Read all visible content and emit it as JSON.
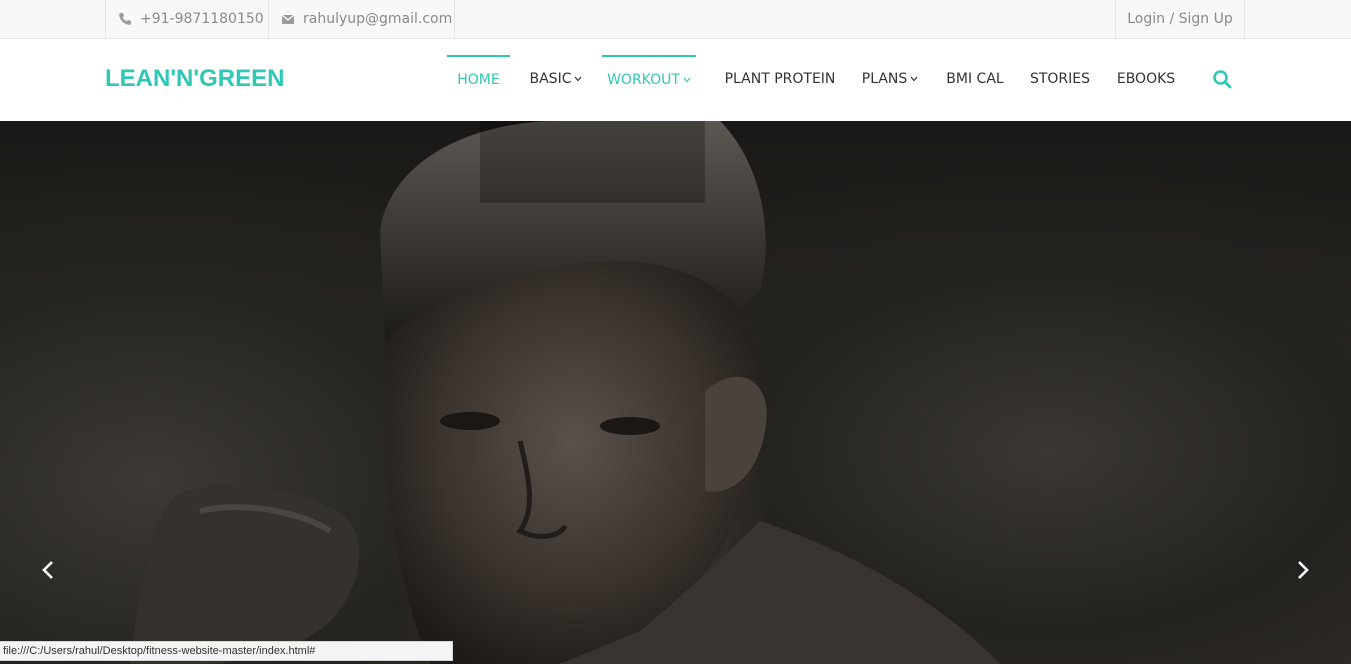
{
  "topbar": {
    "phone": "+91-9871180150",
    "email": "rahulyup@gmail.com",
    "login": "Login / Sign Up"
  },
  "brand": {
    "logo": "LEAN'N'GREEN",
    "accent_color": "#2fc7b6"
  },
  "nav": {
    "items": [
      {
        "label": "HOME",
        "active": true,
        "dropdown": false
      },
      {
        "label": "BASIC",
        "active": false,
        "dropdown": true
      },
      {
        "label": "WORKOUT",
        "active": true,
        "dropdown": true
      },
      {
        "label": "PLANT PROTEIN",
        "active": false,
        "dropdown": false
      },
      {
        "label": "PLANS",
        "active": false,
        "dropdown": true
      },
      {
        "label": "BMI CAL",
        "active": false,
        "dropdown": false
      },
      {
        "label": "STORIES",
        "active": false,
        "dropdown": false
      },
      {
        "label": "EBOOKS",
        "active": false,
        "dropdown": false
      }
    ]
  },
  "icons": {
    "phone": "phone-icon",
    "email": "envelope-icon",
    "search": "search-icon",
    "prev": "chevron-left-icon",
    "next": "chevron-right-icon"
  },
  "statusbar": {
    "url": "file:///C:/Users/rahul/Desktop/fitness-website-master/index.html#"
  }
}
